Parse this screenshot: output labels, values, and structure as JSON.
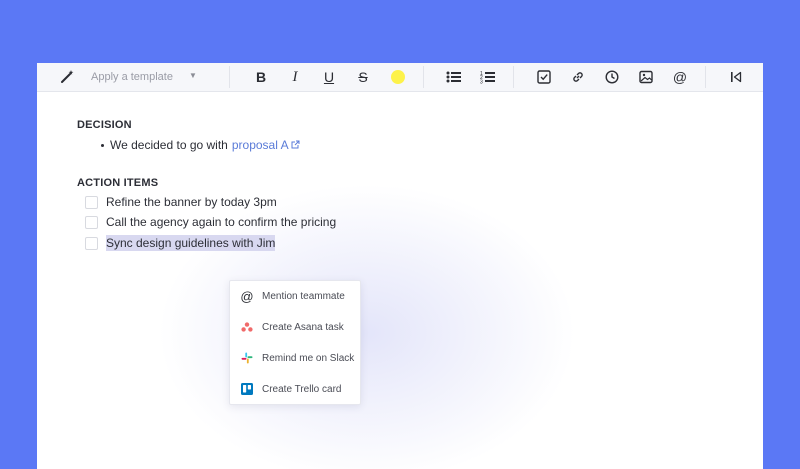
{
  "toolbar": {
    "template_placeholder": "Apply a template",
    "buttons": [
      "bold",
      "italic",
      "underline",
      "strikethrough",
      "highlight",
      "bullet-list",
      "numbered-list",
      "checklist",
      "link",
      "reminder",
      "image",
      "mention",
      "collapse"
    ],
    "highlight_color": "#fdf24a",
    "bold_label": "B",
    "italic_label": "I",
    "underline_label": "U",
    "strike_label": "S"
  },
  "decision": {
    "heading": "DECISION",
    "bullet_text": "We decided to go with",
    "link_text": "proposal A"
  },
  "actions": {
    "heading": "ACTION ITEMS",
    "items": [
      {
        "text": "Refine the banner by today 3pm",
        "checked": false
      },
      {
        "text": "Call the agency again to confirm the pricing",
        "checked": false
      },
      {
        "text": "Sync design guidelines with Jim",
        "checked": false,
        "selected": true
      }
    ]
  },
  "menu": {
    "items": [
      {
        "label": "Mention teammate",
        "icon": "at-icon"
      },
      {
        "label": "Create Asana task",
        "icon": "asana-icon"
      },
      {
        "label": "Remind me on Slack",
        "icon": "slack-icon"
      },
      {
        "label": "Create Trello card",
        "icon": "trello-icon"
      }
    ]
  },
  "colors": {
    "background": "#5b78f5",
    "link": "#5a7bd8",
    "selection": "#d8d8f0",
    "asana": "#f06a6a",
    "trello": "#0079bf"
  }
}
